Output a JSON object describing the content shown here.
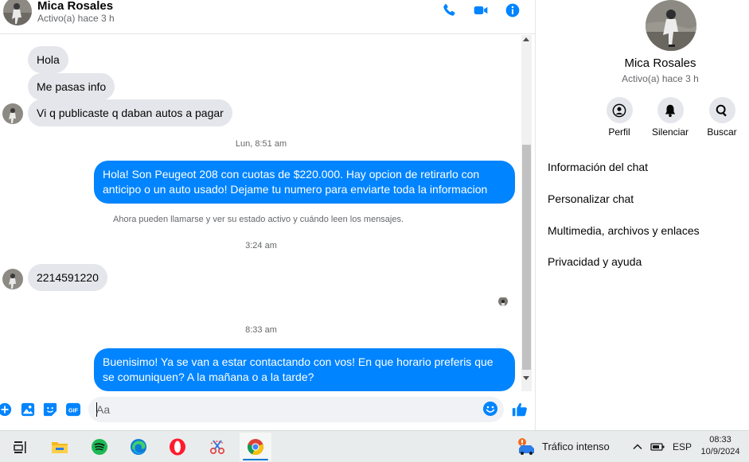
{
  "header": {
    "name": "Mica Rosales",
    "status": "Activo(a) hace 3 h",
    "icons": [
      "phone-icon",
      "video-camera-icon",
      "info-icon"
    ]
  },
  "messages": {
    "m1": "Hola",
    "m2": "Me pasas info",
    "m3": "Vi q publicaste q daban autos a pagar",
    "t1": "Lun, 8:51 am",
    "m4": "Hola! Son Peugeot 208 con cuotas de $220.000. Hay opcion de retirarlo con anticipo o un auto usado! Dejame tu numero para enviarte toda la informacion",
    "notice": "Ahora pueden llamarse y ver su estado activo y cuándo leen los mensajes.",
    "t2": "3:24 am",
    "m5": "2214591220",
    "t3": "8:33 am",
    "m6": "Buenisimo! Ya se van a estar contactando con vos! En que horario preferis que se comuniquen? A la mañana o a la tarde?"
  },
  "composer": {
    "placeholder": "Aa",
    "value": "",
    "gif_label": "GIF",
    "icons": [
      "plus-icon",
      "image-icon",
      "sticker-icon",
      "gif-icon",
      "emoji-icon",
      "thumbs-up-icon"
    ]
  },
  "info_panel": {
    "name": "Mica Rosales",
    "status": "Activo(a) hace 3 h",
    "actions": [
      {
        "label": "Perfil",
        "icon": "profile-icon"
      },
      {
        "label": "Silenciar",
        "icon": "bell-icon"
      },
      {
        "label": "Buscar",
        "icon": "search-icon"
      }
    ],
    "menu": [
      "Información del chat",
      "Personalizar chat",
      "Multimedia, archivos y enlaces",
      "Privacidad y ayuda"
    ]
  },
  "taskbar": {
    "apps": [
      "task-view-icon",
      "file-explorer-icon",
      "spotify-icon",
      "edge-icon",
      "opera-icon",
      "snipping-tool-icon",
      "chrome-icon"
    ],
    "weather": "Tráfico intenso",
    "language": "ESP",
    "time": "08:33",
    "date": "10/9/2024"
  },
  "colors": {
    "accent": "#0084ff",
    "bubble_in": "#e4e6eb",
    "text_secondary": "#65676b"
  }
}
